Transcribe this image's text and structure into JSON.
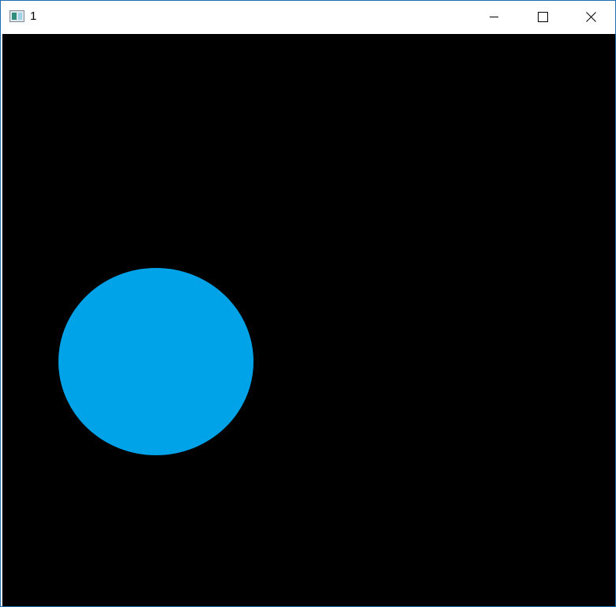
{
  "window": {
    "title": "1",
    "icon": "app-window-icon",
    "controls": {
      "minimize_icon": "minimize-icon",
      "maximize_icon": "maximize-icon",
      "close_icon": "close-icon"
    }
  },
  "canvas": {
    "background_color": "#000000",
    "shape": {
      "type": "circle",
      "fill_color": "#00a2e8"
    }
  },
  "colors": {
    "window_border": "#1f6fb5",
    "titlebar": "#ffffff"
  }
}
